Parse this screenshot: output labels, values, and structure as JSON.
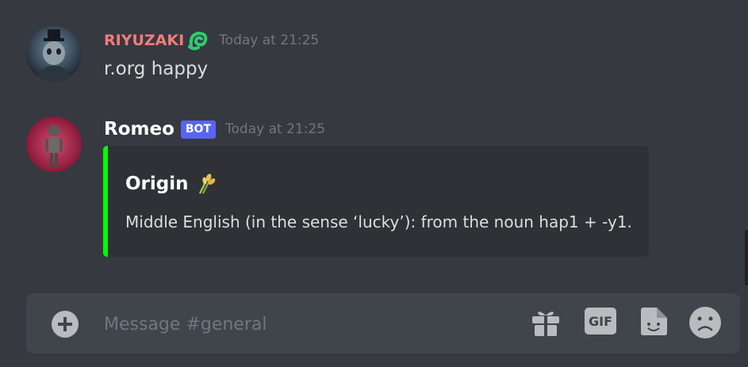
{
  "messages": [
    {
      "author": "RIYUZAKI",
      "author_color": "#f47b7b",
      "badge_icon": "green-snake-icon",
      "timestamp": "Today at 21:25",
      "text": "r.org happy"
    },
    {
      "author": "Romeo",
      "author_color": "#ffffff",
      "bot_label": "BOT",
      "timestamp": "Today at 21:25",
      "embed": {
        "accent_color": "#00ff00",
        "title": "Origin",
        "title_icon": "sheaf-of-rice-icon",
        "description": "Middle English (in the sense ‘lucky’): from the noun hap1 + -y1."
      }
    }
  ],
  "composer": {
    "placeholder": "Message #general",
    "gif_label": "GIF",
    "icons": [
      "add-icon",
      "gift-icon",
      "gif-icon",
      "sticker-icon",
      "emoji-icon"
    ]
  }
}
